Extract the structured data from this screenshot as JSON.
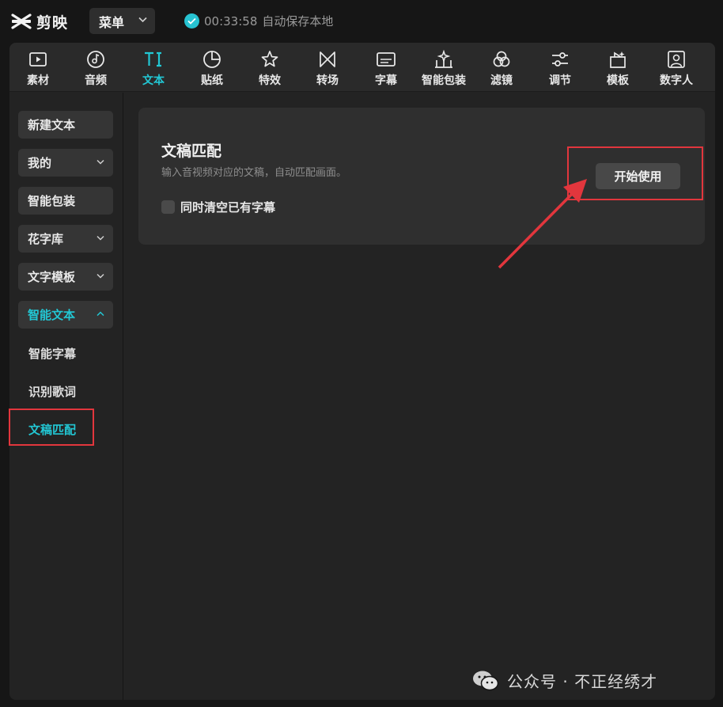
{
  "titlebar": {
    "app_name": "剪映",
    "menu_label": "菜单",
    "save_time": "00:33:58",
    "save_text": "自动保存本地"
  },
  "toolbar": {
    "active": "文本",
    "items": [
      {
        "label": "素材",
        "icon": "media-icon"
      },
      {
        "label": "音频",
        "icon": "audio-icon"
      },
      {
        "label": "文本",
        "icon": "text-icon"
      },
      {
        "label": "贴纸",
        "icon": "sticker-icon"
      },
      {
        "label": "特效",
        "icon": "effects-icon"
      },
      {
        "label": "转场",
        "icon": "transition-icon"
      },
      {
        "label": "字幕",
        "icon": "subtitle-icon"
      },
      {
        "label": "智能包装",
        "icon": "smart-pack-icon"
      },
      {
        "label": "滤镜",
        "icon": "filter-icon"
      },
      {
        "label": "调节",
        "icon": "adjust-icon"
      },
      {
        "label": "模板",
        "icon": "template-icon"
      },
      {
        "label": "数字人",
        "icon": "avatar-icon"
      }
    ]
  },
  "sidebar": {
    "items": [
      {
        "label": "新建文本"
      },
      {
        "label": "我的"
      },
      {
        "label": "智能包装"
      },
      {
        "label": "花字库"
      },
      {
        "label": "文字模板"
      },
      {
        "label": "智能文本"
      }
    ],
    "sub_items": [
      {
        "label": "智能字幕"
      },
      {
        "label": "识别歌词"
      },
      {
        "label": "文稿匹配"
      }
    ],
    "active_sub": "文稿匹配"
  },
  "card": {
    "title": "文稿匹配",
    "description": "输入音视频对应的文稿，自动匹配画面。",
    "checkbox_label": "同时清空已有字幕",
    "checkbox_checked": false,
    "start_button": "开始使用"
  },
  "watermark": {
    "text": "公众号 · 不正经绣才"
  },
  "colors": {
    "accent": "#22c7d4",
    "annotation": "#e2363d",
    "background": "#161616",
    "panel": "#232323"
  }
}
